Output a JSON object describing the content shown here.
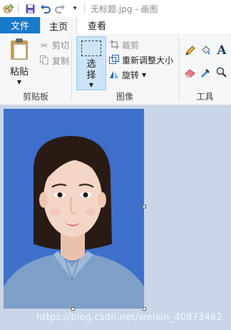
{
  "window": {
    "title": "无标题.jpg - 画图",
    "quick_access": [
      "paint-app-icon",
      "save-icon",
      "undo-icon",
      "redo-icon",
      "customize-dropdown-icon"
    ]
  },
  "tabs": {
    "file": "文件",
    "home": "主页",
    "view": "查看"
  },
  "clipboard": {
    "paste": "粘贴",
    "cut": "剪切",
    "copy": "复制",
    "group_label": "剪贴板"
  },
  "image": {
    "select": "选择",
    "crop": "裁剪",
    "resize": "重新调整大小",
    "rotate": "旋转",
    "group_label": "图像"
  },
  "tools": {
    "group_label": "工具",
    "items": [
      "pencil-icon",
      "fill-bucket-icon",
      "text-tool-icon",
      "eraser-icon",
      "color-picker-icon",
      "magnifier-icon"
    ]
  },
  "canvas": {
    "background_color": "#3d6fcb",
    "watermark": "https://blog.csdn.net/weixin_40873462"
  },
  "colors": {
    "file_tab": "#1979ca",
    "ribbon": "#f5f6f7",
    "workspace": "#c9d6e8",
    "selected_button": "#cce4f7"
  }
}
